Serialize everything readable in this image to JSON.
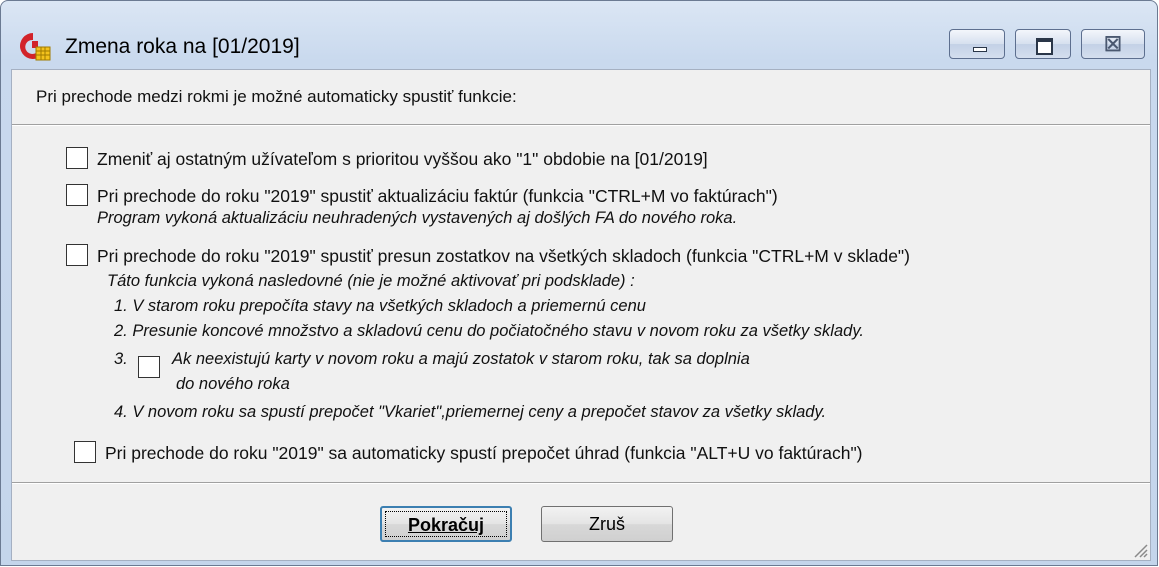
{
  "window": {
    "title": "Zmena roka na [01/2019]",
    "controls": {
      "minimize_icon": "minimize-icon",
      "maximize_icon": "maximize-icon",
      "close_icon": "close-icon",
      "close_glyph": "☒"
    },
    "colors": {
      "titlebar": "#c9d9ee",
      "client": "#f0f0f0"
    }
  },
  "intro": "Pri prechode medzi rokmi je možné automaticky spustiť funkcie:",
  "options": {
    "opt1": {
      "label": "Zmeniť aj ostatným užívateľom s prioritou vyššou ako \"1\" obdobie na [01/2019]",
      "checked": false
    },
    "opt2": {
      "label": "Pri prechode do roku \"2019\" spustiť aktualizáciu faktúr (funkcia \"CTRL+M vo faktúrach\")",
      "note": "Program vykoná aktualizáciu neuhradených vystavených aj došlých FA do nového roka.",
      "checked": false
    },
    "opt3": {
      "label": "Pri prechode do roku \"2019\" spustiť presun zostatkov na všetkých skladoch (funkcia \"CTRL+M v sklade\")",
      "note": "Táto funkcia vykoná nasledovné (nie je možné aktivovať pri podsklade) :",
      "step1": "1. V starom roku prepočíta stavy na všetkých skladoch a priemernú cenu",
      "step2": "2. Presunie koncové množstvo a skladovú cenu do počiatočného stavu v novom roku za všetky sklady.",
      "step3_num": "3.",
      "step3_line1": "Ak neexistujú karty v novom roku a majú zostatok v starom roku, tak sa doplnia",
      "step3_line2": "do nového roka",
      "step4": "4. V novom roku sa spustí prepočet \"Vkariet\",priemernej ceny a  prepočet stavov  za všetky sklady.",
      "checked": false
    },
    "opt4": {
      "label": "Pri prechode do roku \"2019\" sa automaticky spustí prepočet úhrad (funkcia \"ALT+U vo faktúrach\")",
      "checked": false
    }
  },
  "buttons": {
    "ok": "Pokračuj",
    "cancel": "Zruš"
  }
}
